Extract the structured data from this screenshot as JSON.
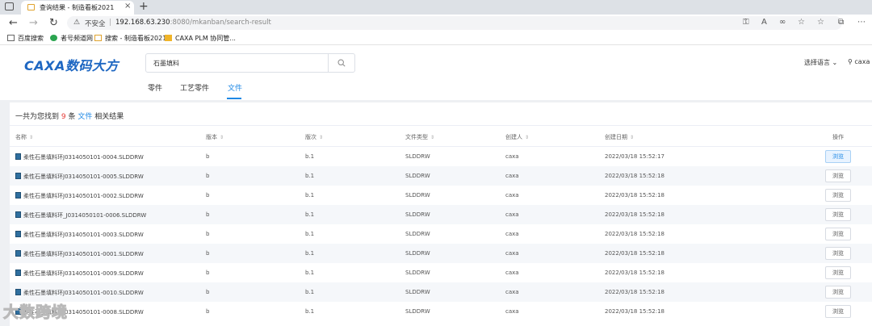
{
  "browser": {
    "tab_title": "查询结果 - 制造看板2021",
    "close_symbol": "×",
    "new_tab_symbol": "+",
    "insecure_label": "不安全",
    "url_host": "192.168.63.230",
    "url_rest": ":8080/mkanban/search-result"
  },
  "bookmarks": [
    {
      "label": "百度搜索"
    },
    {
      "label": "者号频道网"
    },
    {
      "label": "搜索 - 制造看板2021"
    },
    {
      "label": "CAXA PLM 协同管..."
    }
  ],
  "header": {
    "logo": "CAXA数码大方",
    "search_value": "石墨填料",
    "language_label": "选择语言",
    "user_name": "caxa",
    "tabs": [
      {
        "label": "零件",
        "active": false
      },
      {
        "label": "工艺零件",
        "active": false
      },
      {
        "label": "文件",
        "active": true
      }
    ]
  },
  "result": {
    "prefix": "一共为您找到",
    "count": "9",
    "unit": "条",
    "type": "文件",
    "suffix": "相关结果"
  },
  "table": {
    "columns": [
      "名称",
      "版本",
      "版次",
      "文件类型",
      "创建人",
      "创建日期",
      "操作"
    ],
    "rows": [
      {
        "name": "柔性石墨填料环J0314050101-0004.SLDDRW",
        "version": "b",
        "revision": "b.1",
        "file_type": "SLDDRW",
        "creator": "caxa",
        "date": "2022/03/18 15:52:17",
        "action": "浏览"
      },
      {
        "name": "柔性石墨填料环J0314050101-0005.SLDDRW",
        "version": "b",
        "revision": "b.1",
        "file_type": "SLDDRW",
        "creator": "caxa",
        "date": "2022/03/18 15:52:18",
        "action": "浏览"
      },
      {
        "name": "柔性石墨填料环J0314050101-0002.SLDDRW",
        "version": "b",
        "revision": "b.1",
        "file_type": "SLDDRW",
        "creator": "caxa",
        "date": "2022/03/18 15:52:18",
        "action": "浏览"
      },
      {
        "name": "柔性石墨填料环_J0314050101-0006.SLDDRW",
        "version": "b",
        "revision": "b.1",
        "file_type": "SLDDRW",
        "creator": "caxa",
        "date": "2022/03/18 15:52:18",
        "action": "浏览"
      },
      {
        "name": "柔性石墨填料环J0314050101-0003.SLDDRW",
        "version": "b",
        "revision": "b.1",
        "file_type": "SLDDRW",
        "creator": "caxa",
        "date": "2022/03/18 15:52:18",
        "action": "浏览"
      },
      {
        "name": "柔性石墨填料环J0314050101-0001.SLDDRW",
        "version": "b",
        "revision": "b.1",
        "file_type": "SLDDRW",
        "creator": "caxa",
        "date": "2022/03/18 15:52:18",
        "action": "浏览"
      },
      {
        "name": "柔性石墨填料环J0314050101-0009.SLDDRW",
        "version": "b",
        "revision": "b.1",
        "file_type": "SLDDRW",
        "creator": "caxa",
        "date": "2022/03/18 15:52:18",
        "action": "浏览"
      },
      {
        "name": "柔性石墨填料环J0314050101-0010.SLDDRW",
        "version": "b",
        "revision": "b.1",
        "file_type": "SLDDRW",
        "creator": "caxa",
        "date": "2022/03/18 15:52:18",
        "action": "浏览"
      },
      {
        "name": "柔性石墨填料环J0314050101-0008.SLDDRW",
        "version": "b",
        "revision": "b.1",
        "file_type": "SLDDRW",
        "creator": "caxa",
        "date": "2022/03/18 15:52:18",
        "action": "浏览"
      }
    ]
  },
  "watermark": "大数跨境"
}
